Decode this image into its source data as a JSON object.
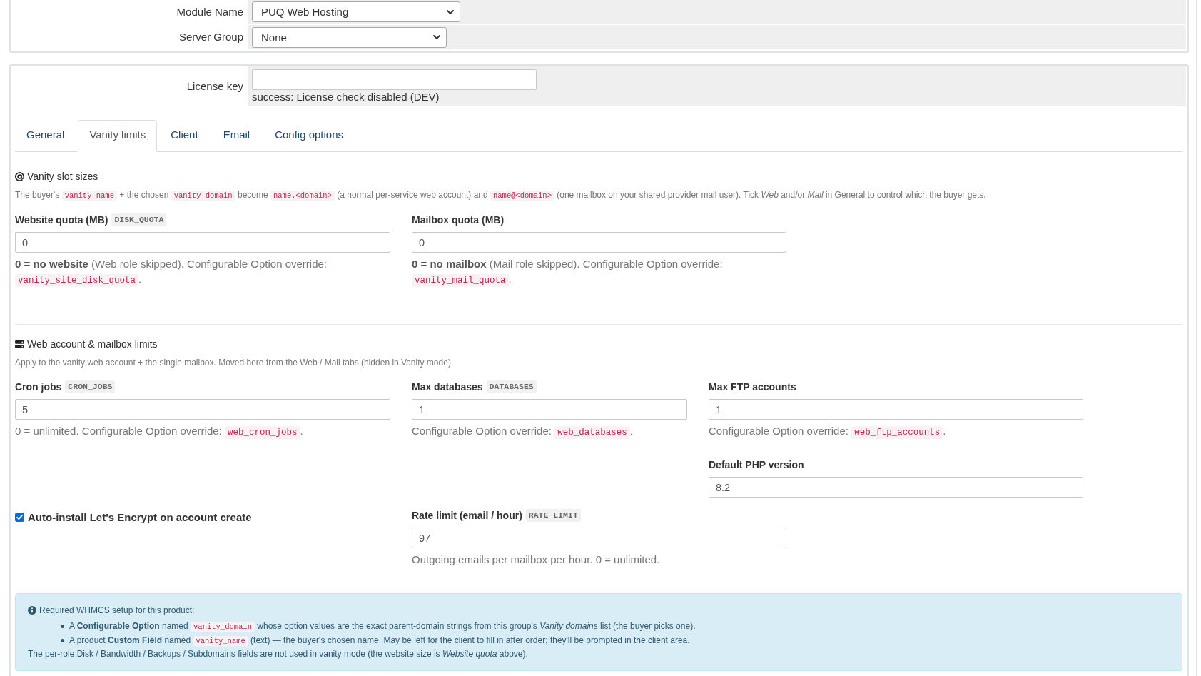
{
  "module_settings": [
    {
      "label": "Module Name",
      "value": "PUQ Web Hosting"
    },
    {
      "label": "Server Group",
      "value": "None"
    }
  ],
  "license": {
    "label": "License key",
    "status": "success: License check disabled (DEV)"
  },
  "tabs": [
    {
      "label": "General",
      "selected": false
    },
    {
      "label": "Vanity limits",
      "selected": true
    },
    {
      "label": "Client",
      "selected": false
    },
    {
      "label": "Email",
      "selected": false
    },
    {
      "label": "Config options",
      "selected": false
    }
  ],
  "sections": [
    {
      "title": "Vanity slot sizes",
      "description": [
        {
          "kind": "text",
          "text": "The buyer's "
        },
        {
          "kind": "code",
          "text": "vanity_name"
        },
        {
          "kind": "text",
          "text": " + the chosen "
        },
        {
          "kind": "code",
          "text": "vanity_domain"
        },
        {
          "kind": "text",
          "text": " become "
        },
        {
          "kind": "code",
          "text": "name.<domain>"
        },
        {
          "kind": "text",
          "text": " (a normal per-service web account) and "
        },
        {
          "kind": "code",
          "text": "name@<domain>"
        },
        {
          "kind": "text",
          "text": " (one mailbox on your shared provider mail user). Tick *Web* and/or *Mail* in General to control which the buyer gets."
        }
      ],
      "fields": [
        {
          "kind": "input",
          "label": "Website quota (MB)",
          "key": "DISK_QUOTA",
          "value": "0",
          "help": [
            {
              "kind": "text",
              "text": "**0 = no website** (Web role skipped). Configurable Option override: "
            },
            {
              "kind": "code",
              "text": "vanity_site_disk_quota"
            },
            {
              "kind": "text",
              "text": "."
            }
          ]
        },
        {
          "kind": "input",
          "label": "Mailbox quota (MB)",
          "value": "0",
          "help": [
            {
              "kind": "text",
              "text": "**0 = no mailbox** (Mail role skipped). Configurable Option override: "
            },
            {
              "kind": "code",
              "text": "vanity_mail_quota"
            },
            {
              "kind": "text",
              "text": "."
            }
          ]
        }
      ]
    },
    {
      "title": "Web account & mailbox limits",
      "description": [
        {
          "kind": "text",
          "text": "Apply to the vanity web account + the single mailbox. Moved here from the Web / Mail tabs (hidden in Vanity mode)."
        }
      ],
      "fields": [
        {
          "kind": "input",
          "label": "Cron jobs",
          "key": "CRON_JOBS",
          "value": "5",
          "help": [
            {
              "kind": "text",
              "text": "0 = unlimited. Configurable Option override: "
            },
            {
              "kind": "code",
              "text": "web_cron_jobs"
            },
            {
              "kind": "text",
              "text": "."
            }
          ]
        },
        {
          "kind": "input",
          "label": "Max databases",
          "key": "DATABASES",
          "value": "1",
          "help": [
            {
              "kind": "text",
              "text": "Configurable Option override: "
            },
            {
              "kind": "code",
              "text": "web_databases"
            },
            {
              "kind": "text",
              "text": "."
            }
          ]
        },
        {
          "kind": "input",
          "label": "Max FTP accounts",
          "value": "1",
          "help": [
            {
              "kind": "text",
              "text": "Configurable Option override: "
            },
            {
              "kind": "code",
              "text": "web_ftp_accounts"
            },
            {
              "kind": "text",
              "text": "."
            }
          ]
        },
        {
          "kind": "input",
          "label": "Default PHP version",
          "value": "8.2"
        },
        {
          "kind": "checkbox",
          "label": "Auto-install Let's Encrypt on account create",
          "checked": true
        },
        {
          "kind": "input",
          "label": "Rate limit (email / hour)",
          "key": "RATE_LIMIT",
          "value": "97",
          "help": [
            {
              "kind": "text",
              "text": "Outgoing emails per mailbox per hour. 0 = unlimited."
            }
          ]
        }
      ]
    }
  ],
  "info_box": {
    "title": "Required WHMCS setup for this product:",
    "items": [
      [
        {
          "kind": "text",
          "text": "A **Configurable Option** named "
        },
        {
          "kind": "code",
          "text": "vanity_domain"
        },
        {
          "kind": "text",
          "text": " whose option values are the exact parent-domain strings from this group's *Vanity domains* list (the buyer picks one)."
        }
      ],
      [
        {
          "kind": "text",
          "text": "A product **Custom Field** named "
        },
        {
          "kind": "code",
          "text": "vanity_name"
        },
        {
          "kind": "text",
          "text": " (text) — the buyer's chosen name. May be left for the client to fill in after order; they'll be prompted in the client area."
        }
      ]
    ],
    "note": "The per-role Disk / Bandwidth / Backups / Subdomains fields are not used in vanity mode (the website size is *Website quota* above)."
  }
}
